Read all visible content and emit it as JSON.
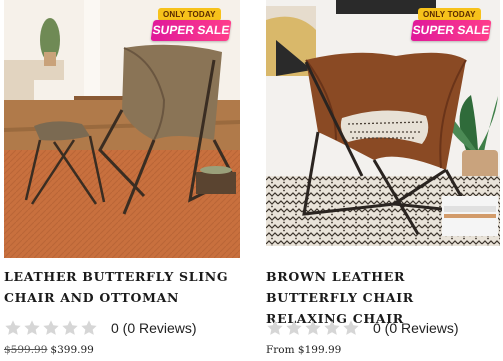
{
  "products": [
    {
      "badge": {
        "top": "ONLY TODAY",
        "main": "SUPER SALE"
      },
      "title": "LEATHER BUTTERFLY SLING CHAIR AND OTTOMAN",
      "rating_text": "0 (0 Reviews)",
      "stars_filled": 0,
      "old_price": "$599.99",
      "price": "$399.99"
    },
    {
      "badge": {
        "top": "ONLY TODAY",
        "main": "SUPER SALE"
      },
      "title": "BROWN LEATHER BUTTERFLY CHAIR RELAXING CHAIR",
      "rating_text": "0 (0 Reviews)",
      "stars_filled": 0,
      "price": "From $199.99"
    }
  ],
  "colors": {
    "star_empty": "#d6d6d6",
    "badge_pink": "#e0199a",
    "badge_yellow": "#f7c21b"
  },
  "icons": {
    "star": "star-icon"
  }
}
